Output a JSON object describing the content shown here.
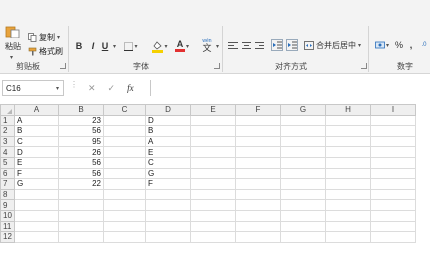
{
  "ribbon": {
    "clipboard": {
      "paste_label": "粘贴",
      "copy_label": "复制",
      "format_painter_label": "格式刷",
      "group_label": "剪贴板"
    },
    "font": {
      "bold": "B",
      "italic": "I",
      "underline": "U",
      "font_color_glyph": "A",
      "phonetic_glyph": "wén",
      "group_label": "字体"
    },
    "alignment": {
      "merge_center_label": "合并后居中",
      "group_label": "对齐方式"
    },
    "number": {
      "percent": "%",
      "comma": ",",
      "group_label": "数字"
    }
  },
  "formula_bar": {
    "name_box": "C16",
    "cancel_glyph": "✕",
    "enter_glyph": "✓",
    "fx_label": "fx",
    "value": ""
  },
  "grid": {
    "columns": [
      "A",
      "B",
      "C",
      "D",
      "E",
      "F",
      "G",
      "H",
      "I"
    ],
    "rows": [
      {
        "num": "1",
        "A": "A",
        "B": "23",
        "D": "D"
      },
      {
        "num": "2",
        "A": "B",
        "B": "56",
        "D": "B"
      },
      {
        "num": "3",
        "A": "C",
        "B": "95",
        "D": "A"
      },
      {
        "num": "4",
        "A": "D",
        "B": "26",
        "D": "E"
      },
      {
        "num": "5",
        "A": "E",
        "B": "56",
        "D": "C"
      },
      {
        "num": "6",
        "A": "F",
        "B": "56",
        "D": "G"
      },
      {
        "num": "7",
        "A": "G",
        "B": "22",
        "D": "F"
      },
      {
        "num": "8"
      },
      {
        "num": "9"
      },
      {
        "num": "10"
      },
      {
        "num": "11"
      },
      {
        "num": "12"
      }
    ]
  },
  "colors": {
    "fill_highlight": "#f5d000",
    "font_red": "#e23030",
    "paste_orange": "#e8a33c"
  }
}
